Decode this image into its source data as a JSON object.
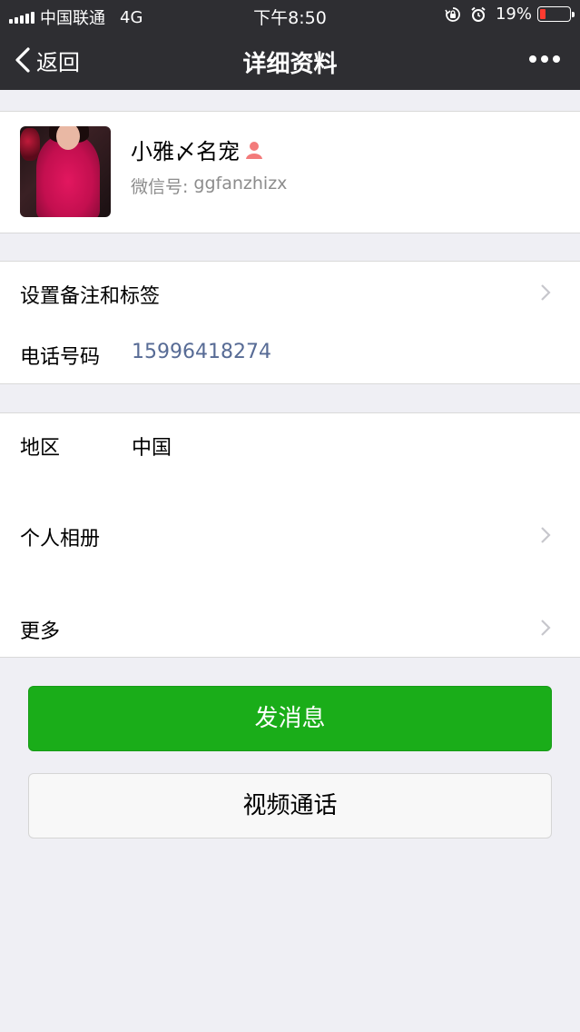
{
  "status_bar": {
    "carrier": "中国联通",
    "network": "4G",
    "time": "下午8:50",
    "battery_percent": "19%",
    "battery_level": 0.19,
    "battery_color": "#ff3b30"
  },
  "nav": {
    "back_label": "返回",
    "title": "详细资料",
    "more_icon": "more-icon"
  },
  "profile": {
    "name": "小雅〆名宠",
    "gender_icon": "female-icon",
    "wechat_id_label": "微信号:",
    "wechat_id": "ggfanzhizx"
  },
  "contact": {
    "remark_label": "设置备注和标签",
    "phone_label": "电话号码",
    "phone_value": "15996418274",
    "phone_color": "#576b95"
  },
  "info": {
    "region_label": "地区",
    "region_value": "中国",
    "album_label": "个人相册",
    "more_label": "更多"
  },
  "actions": {
    "message_label": "发消息",
    "message_color": "#1aad19",
    "video_call_label": "视频通话"
  }
}
